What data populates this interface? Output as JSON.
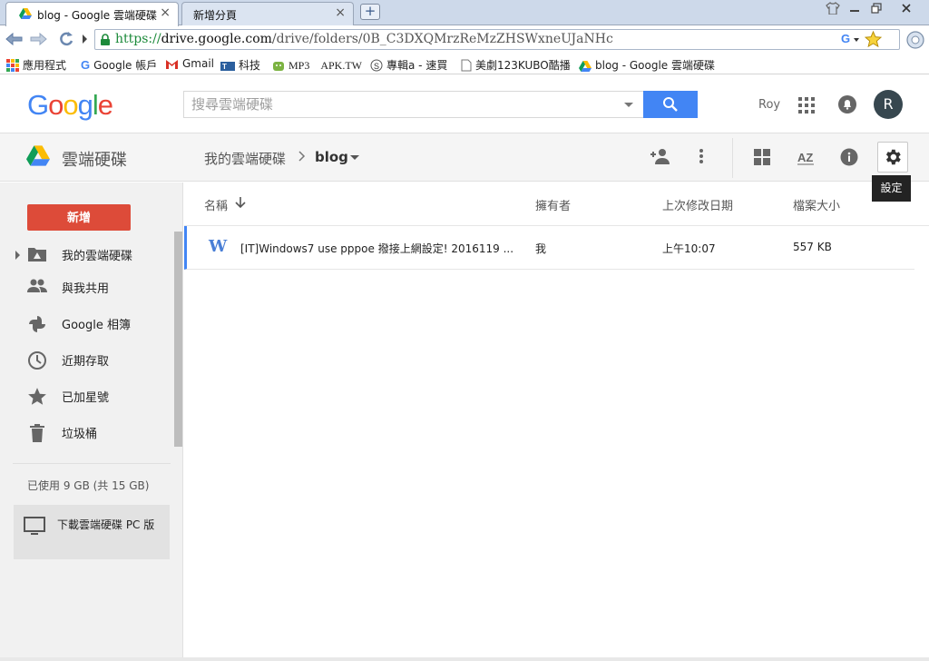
{
  "browser": {
    "tabs": [
      {
        "label": "blog - Google 雲端硬碟",
        "active": true
      },
      {
        "label": "新增分頁",
        "active": false
      }
    ],
    "new_tab_glyph": "+",
    "window_controls": [
      "shirt-icon",
      "minimize-icon",
      "restore-icon",
      "close-icon"
    ],
    "url": {
      "scheme": "https://",
      "host": "drive.google.com",
      "path": "/drive/folders/0B_C3DXQMrzReMzZHSWxneUJaNHc"
    },
    "bookmarks": [
      {
        "label": "應用程式",
        "icon": "apps-grid-icon"
      },
      {
        "label": "Google 帳戶",
        "icon": "google-g-icon"
      },
      {
        "label": "Gmail",
        "icon": "gmail-icon"
      },
      {
        "label": "科技",
        "icon": "tech-icon"
      },
      {
        "label": "MP3　APK.TW",
        "icon": "apk-icon"
      },
      {
        "label": "專輯a - 速買",
        "icon": "s-icon"
      },
      {
        "label": "美劇123KUBO酷播",
        "icon": "page-icon"
      },
      {
        "label": "blog - Google 雲端硬碟",
        "icon": "drive-icon"
      }
    ]
  },
  "header": {
    "logo": "Google",
    "search_placeholder": "搜尋雲端硬碟",
    "user_name": "Roy",
    "avatar_letter": "R"
  },
  "appbar": {
    "app_name": "雲端硬碟",
    "breadcrumb": [
      "我的雲端硬碟",
      "blog"
    ],
    "settings_tooltip": "設定"
  },
  "sidebar": {
    "new_button": "新增",
    "items": [
      {
        "label": "我的雲端硬碟",
        "icon": "my-drive-icon"
      },
      {
        "label": "與我共用",
        "icon": "shared-people-icon"
      },
      {
        "label": "Google 相簿",
        "icon": "photos-pinwheel-icon"
      },
      {
        "label": "近期存取",
        "icon": "clock-icon"
      },
      {
        "label": "已加星號",
        "icon": "star-icon"
      },
      {
        "label": "垃圾桶",
        "icon": "trash-icon"
      }
    ],
    "storage": "已使用 9 GB (共 15 GB)",
    "download_label": "下載雲端硬碟 PC 版"
  },
  "file_list": {
    "columns": [
      "名稱",
      "擁有者",
      "上次修改日期",
      "檔案大小"
    ],
    "rows": [
      {
        "icon_glyph": "W",
        "name": "[IT]Windows7 use pppoe 撥接上網設定! 2016119 ...",
        "owner": "我",
        "modified": "上午10:07",
        "size": "557 KB"
      }
    ]
  },
  "colors": {
    "new_button": "#dd4b39",
    "search_button": "#4285f4",
    "avatar": "#37474f",
    "selection": "#4285f4"
  }
}
